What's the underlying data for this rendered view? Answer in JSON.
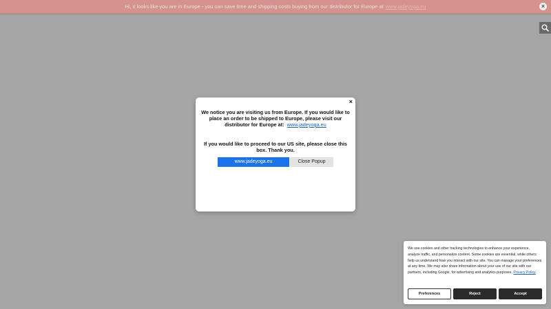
{
  "banner": {
    "text": "Hi, it looks like you are in Europe - you can save time and shipping costs buying from our distributor for Europe at",
    "link": "www.jadeyoga.eu",
    "close_symbol": "×",
    "color": "#d6928c"
  },
  "search": {
    "icon": "search-icon"
  },
  "modal": {
    "close_symbol": "×",
    "message_1": "We notice you are visiting us from Europe.  If you would like to place an order to be shipped to Europe, please visit our distributor for Europe at:",
    "message_1_link": "www.jadeyoga.eu",
    "message_2": "If you would like to proceed to our US site, please close this box. Thank you.",
    "primary_button": "www.jadeyoga.eu",
    "secondary_button": "Close Popup",
    "primary_color": "#1a73e8"
  },
  "cookie": {
    "text": "We use cookies and other tracking technologies to enhance your experience, analyze traffic, and personalize content. Some cookies are essential, while others help us understand how you interact with our site. You can manage your preferences at any time. We may also share information about your use of our site with our partners, including Google, for advertising and analytics purposes.",
    "policy_link": "Privacy Policy",
    "buttons": {
      "preferences": "Preferences",
      "reject": "Reject",
      "accept": "Accept"
    }
  }
}
